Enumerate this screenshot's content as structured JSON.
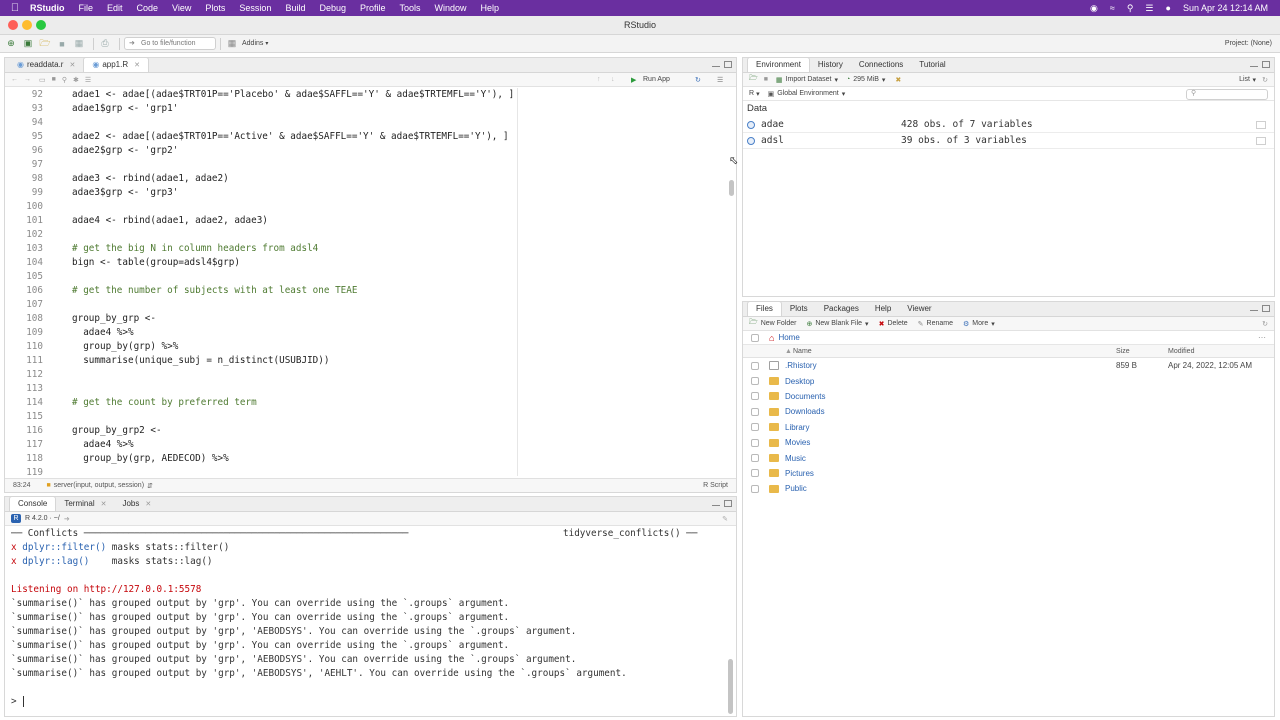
{
  "menubar": {
    "app": "RStudio",
    "items": [
      "File",
      "Edit",
      "Code",
      "View",
      "Plots",
      "Session",
      "Build",
      "Debug",
      "Profile",
      "Tools",
      "Window",
      "Help"
    ],
    "clock": "Sun Apr 24  12:14 AM"
  },
  "window": {
    "title": "RStudio"
  },
  "toolbar": {
    "goto_placeholder": "Go to file/function",
    "addins": "Addins",
    "project": "Project: (None)"
  },
  "editor": {
    "tabs": [
      {
        "label": "readdata.r"
      },
      {
        "label": "app1.R"
      }
    ],
    "run_app": "Run App",
    "lines": [
      {
        "n": "92",
        "code": "adae1 <- adae[(adae$TRT01P=='Placebo' & adae$SAFFL=='Y' & adae$TRTEMFL=='Y'), ]"
      },
      {
        "n": "93",
        "code": "adae1$grp <- 'grp1'"
      },
      {
        "n": "94",
        "code": ""
      },
      {
        "n": "95",
        "code": "adae2 <- adae[(adae$TRT01P=='Active' & adae$SAFFL=='Y' & adae$TRTEMFL=='Y'), ]"
      },
      {
        "n": "96",
        "code": "adae2$grp <- 'grp2'"
      },
      {
        "n": "97",
        "code": ""
      },
      {
        "n": "98",
        "code": "adae3 <- rbind(adae1, adae2)"
      },
      {
        "n": "99",
        "code": "adae3$grp <- 'grp3'"
      },
      {
        "n": "100",
        "code": ""
      },
      {
        "n": "101",
        "code": "adae4 <- rbind(adae1, adae2, adae3)"
      },
      {
        "n": "102",
        "code": ""
      },
      {
        "n": "103",
        "code": "# get the big N in column headers from adsl4"
      },
      {
        "n": "104",
        "code": "bign <- table(group=adsl4$grp)"
      },
      {
        "n": "105",
        "code": ""
      },
      {
        "n": "106",
        "code": "# get the number of subjects with at least one TEAE"
      },
      {
        "n": "107",
        "code": ""
      },
      {
        "n": "108",
        "code": "group_by_grp <-"
      },
      {
        "n": "109",
        "code": "  adae4 %>%"
      },
      {
        "n": "110",
        "code": "  group_by(grp) %>%"
      },
      {
        "n": "111",
        "code": "  summarise(unique_subj = n_distinct(USUBJID))"
      },
      {
        "n": "112",
        "code": ""
      },
      {
        "n": "113",
        "code": ""
      },
      {
        "n": "114",
        "code": "# get the count by preferred term"
      },
      {
        "n": "115",
        "code": ""
      },
      {
        "n": "116",
        "code": "group_by_grp2 <-"
      },
      {
        "n": "117",
        "code": "  adae4 %>%"
      },
      {
        "n": "118",
        "code": "  group_by(grp, AEDECOD) %>%"
      },
      {
        "n": "119",
        "code": ""
      }
    ],
    "status": {
      "position": "83:24",
      "function": "server(input, output, session)",
      "filetype": "R Script"
    }
  },
  "console": {
    "tabs": [
      "Console",
      "Terminal",
      "Jobs"
    ],
    "r_version": "R 4.2.0 · ~/",
    "conflicts_header_left": "── Conflicts ──────────────────────────────────────────────────────────",
    "conflicts_header_right": "tidyverse_conflicts() ──",
    "conflicts": [
      {
        "mark": "x",
        "fn": "dplyr::filter()",
        "text": " masks stats::filter()"
      },
      {
        "mark": "x",
        "fn": "dplyr::lag()   ",
        "text": " masks stats::lag()"
      }
    ],
    "listening": "Listening on http://127.0.0.1:5578",
    "messages": [
      "`summarise()` has grouped output by 'grp'. You can override using the `.groups` argument.",
      "`summarise()` has grouped output by 'grp'. You can override using the `.groups` argument.",
      "`summarise()` has grouped output by 'grp', 'AEBODSYS'. You can override using the `.groups` argument.",
      "`summarise()` has grouped output by 'grp'. You can override using the `.groups` argument.",
      "`summarise()` has grouped output by 'grp', 'AEBODSYS'. You can override using the `.groups` argument.",
      "`summarise()` has grouped output by 'grp', 'AEBODSYS', 'AEHLT'. You can override using the `.groups` argument."
    ],
    "prompt": ">"
  },
  "environment": {
    "tabs": [
      "Environment",
      "History",
      "Connections",
      "Tutorial"
    ],
    "import": "Import Dataset",
    "memory": "295 MiB",
    "view_mode": "List",
    "lang": "R",
    "scope": "Global Environment",
    "section": "Data",
    "items": [
      {
        "name": "adae",
        "value": "428 obs. of 7 variables"
      },
      {
        "name": "adsl",
        "value": "39 obs. of 3 variables"
      }
    ]
  },
  "files": {
    "tabs": [
      "Files",
      "Plots",
      "Packages",
      "Help",
      "Viewer"
    ],
    "toolbar": {
      "new_folder": "New Folder",
      "new_blank": "New Blank File",
      "delete": "Delete",
      "rename": "Rename",
      "more": "More"
    },
    "crumb": "Home",
    "headers": {
      "name": "Name",
      "size": "Size",
      "modified": "Modified"
    },
    "rows": [
      {
        "name": ".Rhistory",
        "kind": "file",
        "size": "859 B",
        "modified": "Apr 24, 2022, 12:05 AM"
      },
      {
        "name": "Desktop",
        "kind": "folder",
        "size": "",
        "modified": ""
      },
      {
        "name": "Documents",
        "kind": "folder",
        "size": "",
        "modified": ""
      },
      {
        "name": "Downloads",
        "kind": "folder",
        "size": "",
        "modified": ""
      },
      {
        "name": "Library",
        "kind": "folder",
        "size": "",
        "modified": ""
      },
      {
        "name": "Movies",
        "kind": "folder",
        "size": "",
        "modified": ""
      },
      {
        "name": "Music",
        "kind": "folder",
        "size": "",
        "modified": ""
      },
      {
        "name": "Pictures",
        "kind": "folder",
        "size": "",
        "modified": ""
      },
      {
        "name": "Public",
        "kind": "folder",
        "size": "",
        "modified": ""
      }
    ]
  },
  "colors": {
    "menubar": "#6a2fa0",
    "accent_green": "#3a7a3a",
    "link_blue": "#2a62b0",
    "error_red": "#c5060b"
  }
}
